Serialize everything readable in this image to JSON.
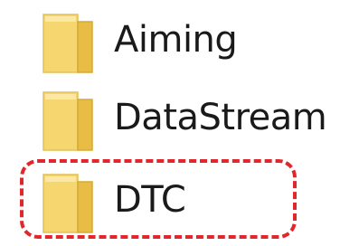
{
  "folders": [
    {
      "name": "Aiming",
      "icon": "folder-icon"
    },
    {
      "name": "DataStream",
      "icon": "folder-icon"
    },
    {
      "name": "DTC",
      "icon": "folder-icon"
    }
  ],
  "highlight": {
    "target": "DTC",
    "color": "#e3262c",
    "style": "dashed"
  },
  "colors": {
    "folder_body": "#f6d66e",
    "folder_shade": "#e7bd45",
    "folder_light": "#fbe8a4"
  }
}
